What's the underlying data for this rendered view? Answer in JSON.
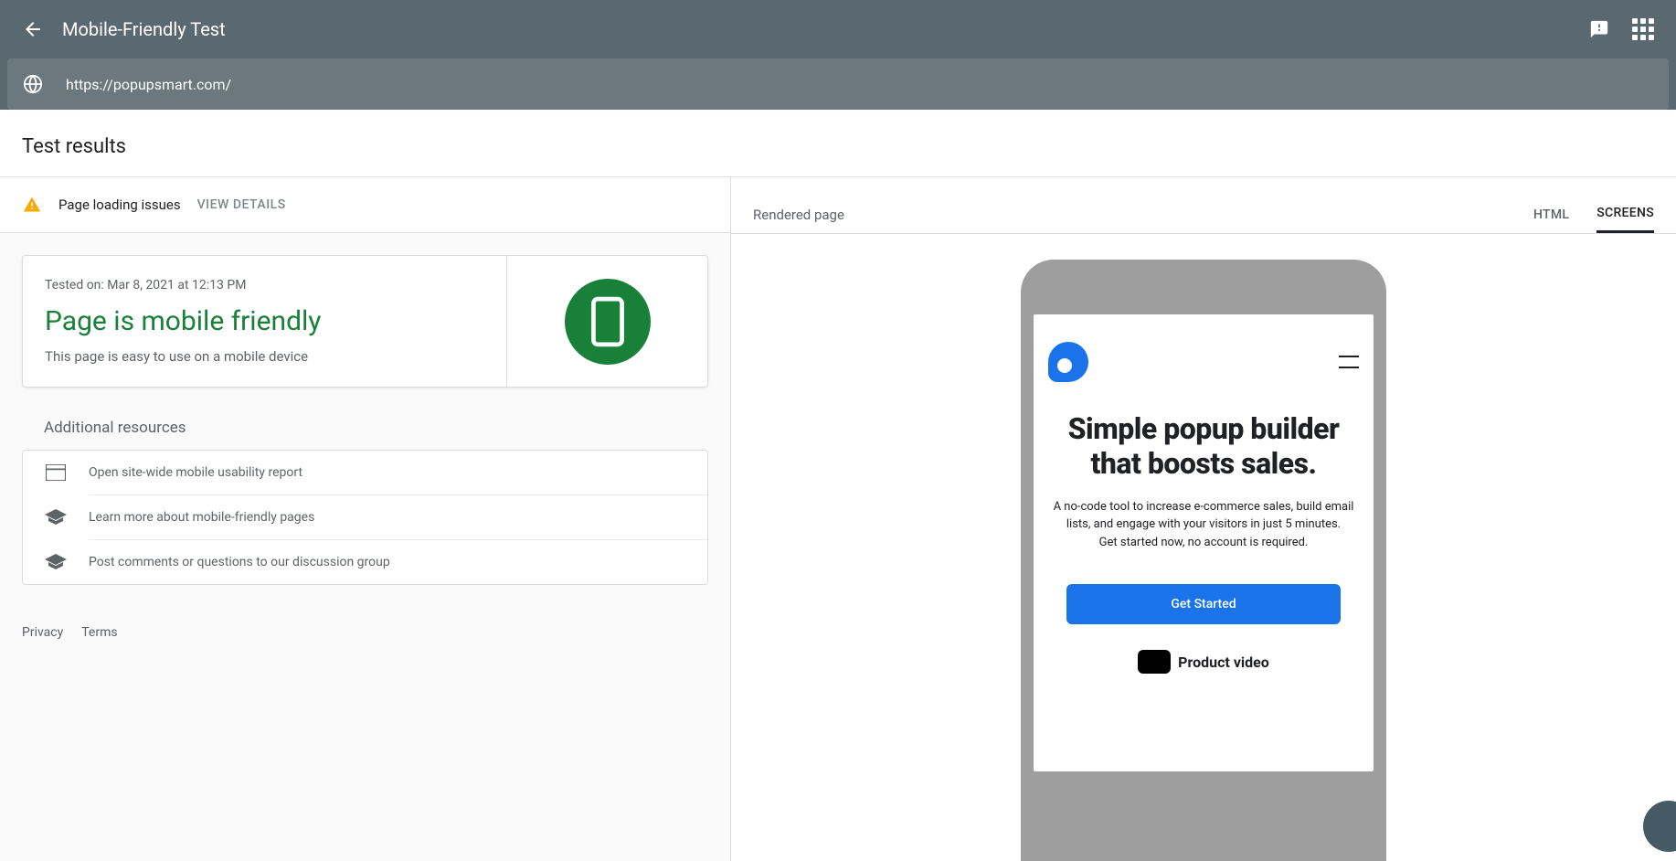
{
  "header": {
    "title": "Mobile-Friendly Test",
    "url": "https://popupsmart.com/"
  },
  "section_title": "Test results",
  "issues": {
    "label": "Page loading issues",
    "view_details": "VIEW DETAILS"
  },
  "result": {
    "tested_on": "Tested on: Mar 8, 2021 at 12:13 PM",
    "title": "Page is mobile friendly",
    "subtitle": "This page is easy to use on a mobile device"
  },
  "additional": {
    "title": "Additional resources",
    "items": [
      "Open site-wide mobile usability report",
      "Learn more about mobile-friendly pages",
      "Post comments or questions to our discussion group"
    ]
  },
  "footer": {
    "privacy": "Privacy",
    "terms": "Terms"
  },
  "right": {
    "label": "Rendered page",
    "tab_html": "HTML",
    "tab_screens": "SCREENS"
  },
  "preview": {
    "headline": "Simple popup builder that boosts sales.",
    "desc": "A no-code tool to increase e-commerce sales, build email lists, and engage with your visitors in just 5 minutes.\nGet started now, no account is required.",
    "cta": "Get Started",
    "bottom": "Product video"
  }
}
